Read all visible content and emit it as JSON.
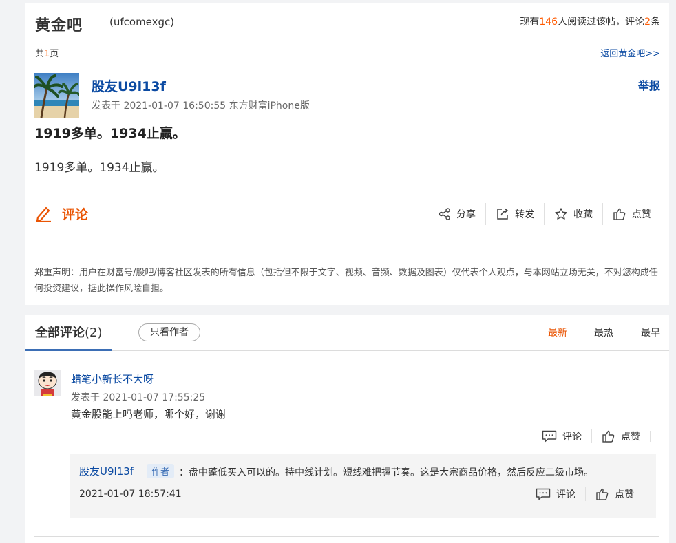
{
  "bar": {
    "name": "黄金吧",
    "code": "(ufcomexgc)",
    "read_prefix": "现有",
    "read_count": "146",
    "read_mid": "人阅读过该帖，评论",
    "comment_count": "2",
    "read_suffix": "条"
  },
  "pager": {
    "prefix": "共",
    "pages": "1",
    "suffix": "页",
    "back_link": "返回黄金吧>>"
  },
  "post": {
    "author": "股友U9l13f",
    "meta": "发表于 2021-01-07 16:50:55 东方财富iPhone版",
    "report_label": "举报",
    "title": "1919多单。1934止赢。",
    "body": "1919多单。1934止赢。",
    "comment_label": "评论",
    "actions": {
      "share": "分享",
      "forward": "转发",
      "favorite": "收藏",
      "like": "点赞"
    },
    "disclaimer": "郑重声明：用户在财富号/股吧/博客社区发表的所有信息（包括但不限于文字、视频、音频、数据及图表）仅代表个人观点，与本网站立场无关，不对您构成任何投资建议，据此操作风险自担。"
  },
  "comments_section": {
    "tab_label": "全部评论",
    "tab_count": "(2)",
    "only_author": "只看作者",
    "sort": {
      "newest": "最新",
      "hottest": "最热",
      "earliest": "最早"
    },
    "active_sort_color": "#ea5504"
  },
  "comment": {
    "user": "蜡笔小新长不大呀",
    "meta": "发表于 2021-01-07 17:55:25",
    "text": "黄金股能上吗老师，哪个好，谢谢",
    "comment_label": "评论",
    "like_label": "点赞"
  },
  "reply": {
    "user": "股友U9l13f",
    "tag": "作者",
    "text": "：盘中蓬低买入可以的。持中线计划。短线难把握节奏。这是大宗商品价格，然后反应二级市场。",
    "date": "2021-01-07 18:57:41",
    "comment_label": "评论",
    "like_label": "点赞"
  },
  "colors": {
    "accent": "#ea5504",
    "link": "#0b4aa2",
    "highlight": "#ff5a00"
  }
}
